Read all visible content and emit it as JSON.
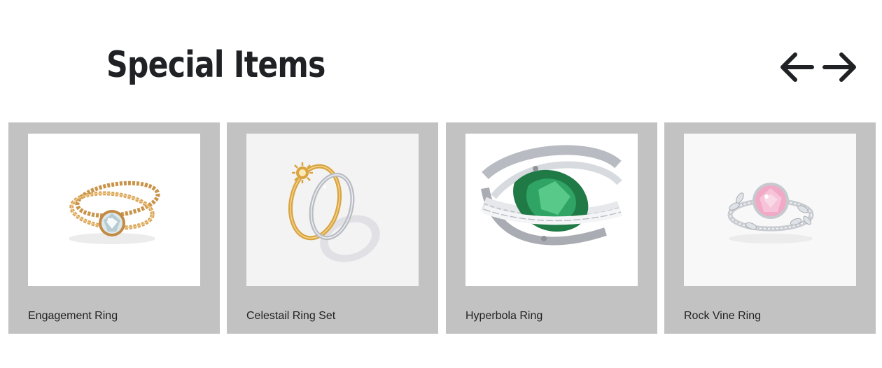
{
  "section": {
    "title": "Special Items"
  },
  "carousel": {
    "prev_icon": "arrow-left-icon",
    "next_icon": "arrow-right-icon"
  },
  "products": [
    {
      "name": "Engagement Ring",
      "image": "gold-twisted-ring-with-diamond"
    },
    {
      "name": "Celestail Ring Set",
      "image": "sun-and-moon-ring-set"
    },
    {
      "name": "Hyperbola Ring",
      "image": "silver-ring-with-green-stone"
    },
    {
      "name": "Rock Vine Ring",
      "image": "silver-vine-ring-with-pink-stone"
    }
  ],
  "colors": {
    "card_background": "#c2c2c2",
    "title": "#1f2125",
    "text": "#222222"
  }
}
